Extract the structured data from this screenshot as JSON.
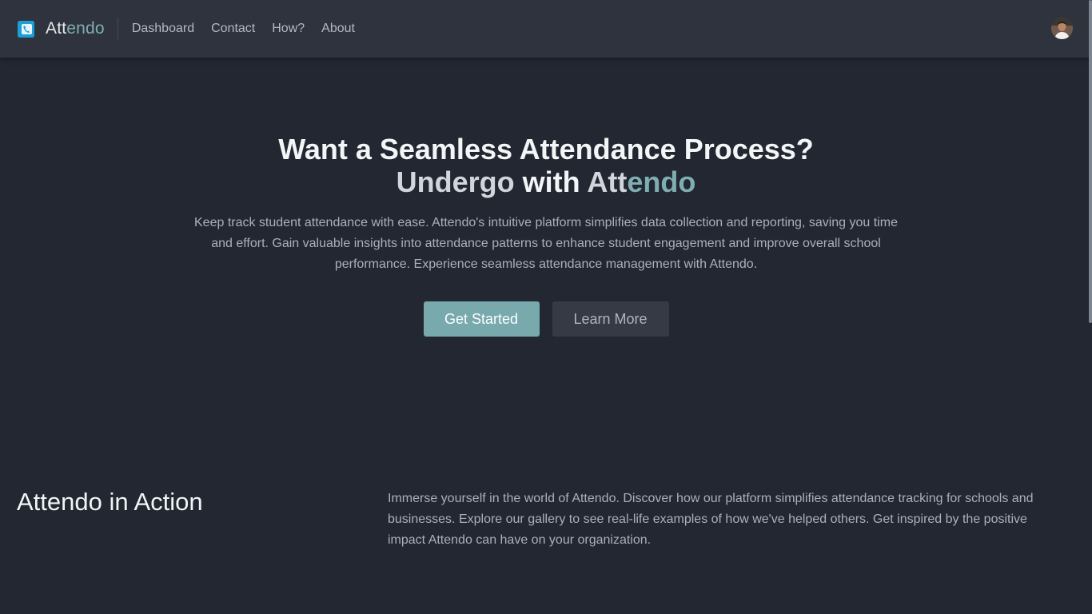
{
  "brand": {
    "name_part1": "Att",
    "name_part2": "en",
    "name_part3": "do",
    "logo_icon": "phone-icon"
  },
  "nav": {
    "links": [
      {
        "label": "Dashboard"
      },
      {
        "label": "Contact"
      },
      {
        "label": "How?"
      },
      {
        "label": "About"
      }
    ]
  },
  "user": {
    "avatar_icon": "user-avatar"
  },
  "hero": {
    "title_line1": "Want a Seamless Attendance Process?",
    "title_word1": "Undergo",
    "title_word2": " with ",
    "title_word3": "Att",
    "title_word4": "endo",
    "description": "Keep track student attendance with ease. Attendo's intuitive platform simplifies data collection and reporting, saving you time and effort. Gain valuable insights into attendance patterns to enhance student engagement and improve overall school performance. Experience seamless attendance management with Attendo.",
    "primary_button": "Get Started",
    "secondary_button": "Learn More"
  },
  "action": {
    "title": "Attendo in Action",
    "description": "Immerse yourself in the world of Attendo. Discover how our platform simplifies attendance tracking for schools and businesses. Explore our gallery to see real-life examples of how we've helped others. Get inspired by the positive impact Attendo can have on your organization."
  },
  "colors": {
    "background": "#222731",
    "navbar": "#2e333d",
    "accent": "#77a9ad",
    "logo": "#1b9fd6"
  }
}
